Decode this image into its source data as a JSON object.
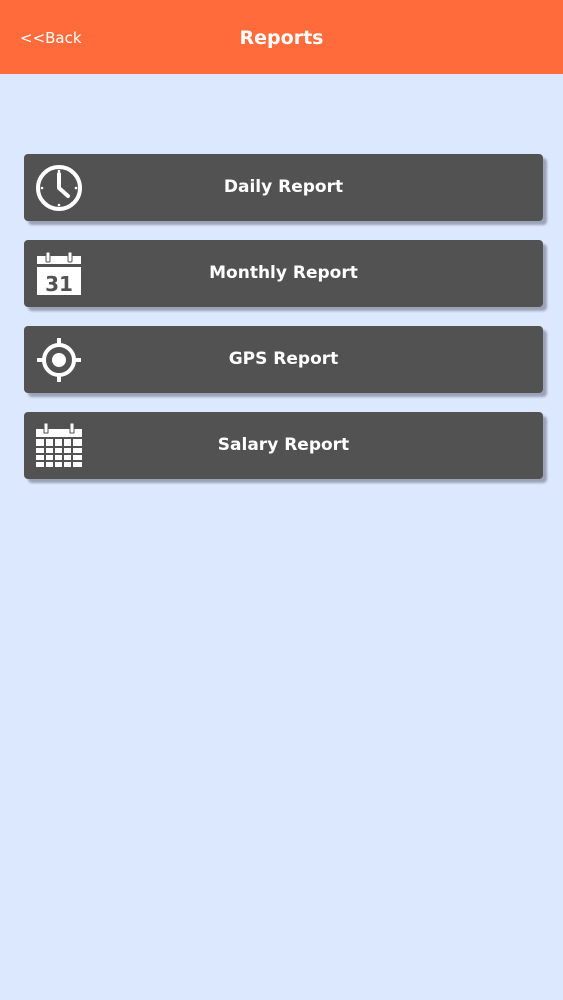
{
  "header": {
    "back_label": "<<Back",
    "title": "Reports",
    "background_color": "#ff6b3b"
  },
  "reports": [
    {
      "label": "Daily Report",
      "icon": "clock-icon"
    },
    {
      "label": "Monthly Report",
      "icon": "calendar-31-icon",
      "icon_text": "31"
    },
    {
      "label": "GPS Report",
      "icon": "gps-target-icon"
    },
    {
      "label": "Salary Report",
      "icon": "calendar-grid-icon"
    }
  ],
  "colors": {
    "page_background": "#dce8fd",
    "button_background": "#525252",
    "text": "#ffffff"
  }
}
